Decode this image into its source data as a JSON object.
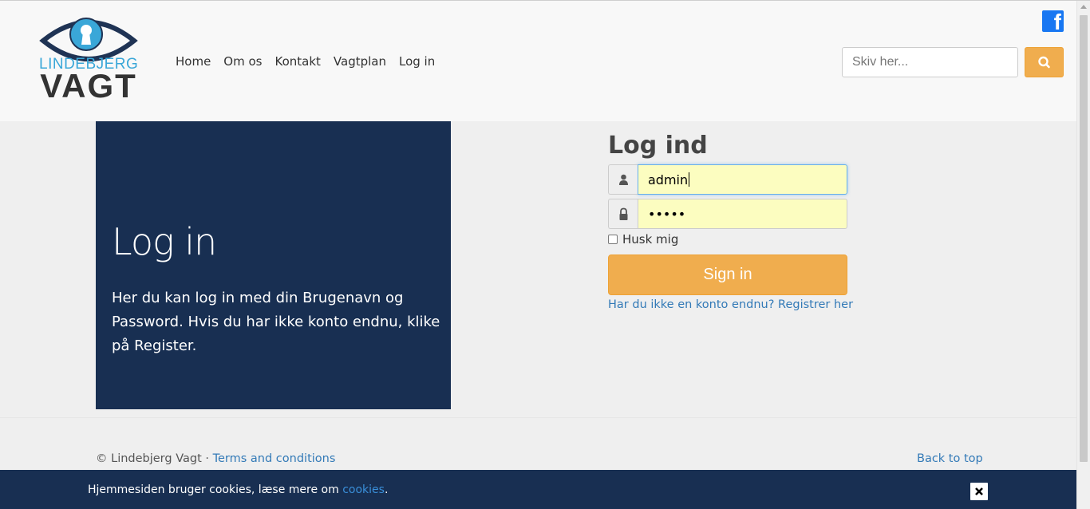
{
  "header": {
    "logo": {
      "top_text": "LINDEBJERG",
      "bottom_text": "VAGT"
    },
    "nav": [
      "Home",
      "Om os",
      "Kontakt",
      "Vagtplan",
      "Log in"
    ],
    "search_placeholder": "Skiv her...",
    "facebook_icon": "facebook-icon",
    "search_icon": "search-icon"
  },
  "hero": {
    "title": "Log in",
    "text": "Her du kan log in med din Brugenavn og Password. Hvis du har ikke konto endnu, klike på Register."
  },
  "login": {
    "title": "Log ind",
    "username_value": "admin",
    "password_value": "•••••",
    "remember_label": "Husk mig",
    "signin_label": "Sign in",
    "register_link": "Har du ikke en konto endnu? Registrer her"
  },
  "footer": {
    "copyright": "© Lindebjerg Vagt · ",
    "terms": "Terms and conditions",
    "back_to_top": "Back to top"
  },
  "cookie": {
    "text": "Hjemmesiden bruger cookies, læse mere om ",
    "link": "cookies",
    "suffix": "."
  },
  "colors": {
    "navy": "#182f52",
    "accent": "#f0ad4e",
    "link": "#337ab7",
    "autofill": "#fcfdc0",
    "logo_blue": "#3aa7d8"
  }
}
